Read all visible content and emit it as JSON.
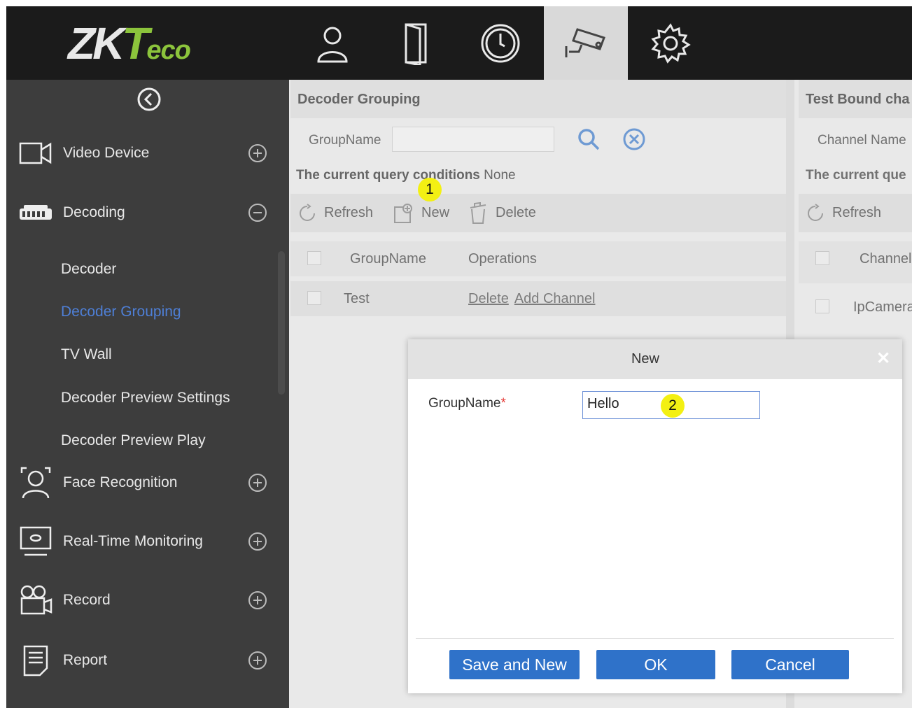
{
  "logo": {
    "zk": "ZK",
    "t": "T",
    "eco": "eco"
  },
  "topnav": [
    {
      "name": "personnel-icon"
    },
    {
      "name": "access-door-icon"
    },
    {
      "name": "attendance-clock-icon"
    },
    {
      "name": "video-camera-icon",
      "active": true
    },
    {
      "name": "system-gear-icon"
    }
  ],
  "sidebar": {
    "collapse_icon": "chevron-left-circle-icon",
    "video_device": "Video Device",
    "decoding": "Decoding",
    "decoder": "Decoder",
    "decoder_grouping": "Decoder Grouping",
    "tv_wall": "TV Wall",
    "decoder_preview_settings": "Decoder Preview Settings",
    "decoder_preview_play": "Decoder Preview Play",
    "face_recognition": "Face Recognition",
    "realtime_monitoring": "Real-Time Monitoring",
    "record": "Record",
    "report": "Report"
  },
  "main": {
    "title": "Decoder Grouping",
    "filter_label": "GroupName",
    "filter_value": "",
    "conditions_label": "The current query conditions",
    "conditions_value": "None",
    "toolbar": {
      "refresh": "Refresh",
      "new": "New",
      "delete": "Delete"
    },
    "table": {
      "headers": [
        "GroupName",
        "Operations"
      ],
      "rows": [
        {
          "groupname": "Test",
          "ops": [
            "Delete",
            "Add Channel"
          ]
        }
      ]
    }
  },
  "right": {
    "title": "Test Bound cha",
    "filter_label": "Channel Name",
    "conditions_label": "The current que",
    "refresh": "Refresh",
    "header_channel": "Channel",
    "row_channel": "IpCamera"
  },
  "modal": {
    "title": "New",
    "field_label": "GroupName",
    "required_mark": "*",
    "field_value": "Hello",
    "save_and_new": "Save and New",
    "ok": "OK",
    "cancel": "Cancel"
  },
  "markers": {
    "one": "1",
    "two": "2"
  },
  "colors": {
    "accent": "#2f72c9",
    "sidebar_bg": "#3d3d3d",
    "active_link": "#4e7fd6",
    "marker": "#f3f013"
  }
}
